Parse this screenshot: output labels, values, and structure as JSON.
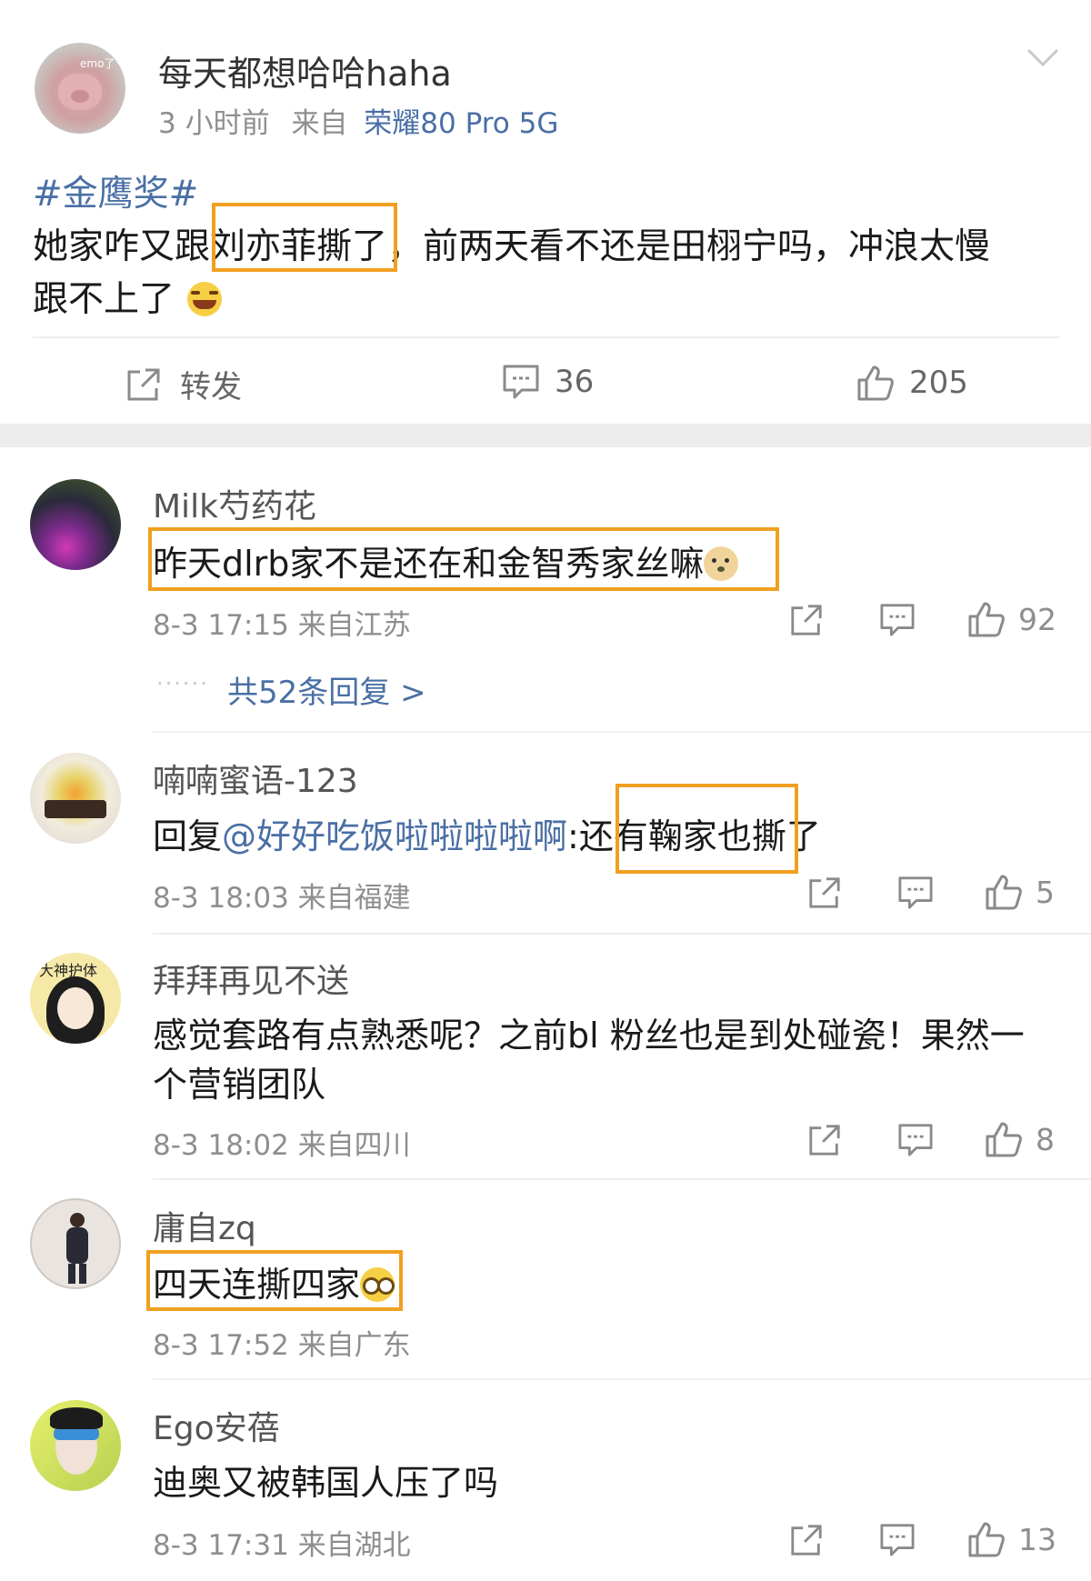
{
  "post": {
    "author": "每天都想哈哈haha",
    "time": "3 小时前",
    "from_prefix": "来自",
    "device": "荣耀80 Pro 5G",
    "hashtag": "#金鹰奖#",
    "text_line1": "她家咋又跟刘亦菲撕了，前两天看不还是田栩宁吗，冲浪太慢",
    "text_line2": "跟不上了",
    "avatar_badge": "emo了",
    "actions": {
      "repost_label": "转发",
      "comment_count": "36",
      "like_count": "205"
    }
  },
  "comments": [
    {
      "name": "Milk芍药花",
      "text": "昨天dlrb家不是还在和金智秀家丝嘛",
      "meta": "8-3 17:15 来自江苏",
      "likes": "92",
      "replies_label": "共52条回复 >"
    },
    {
      "name": "喃喃蜜语-123",
      "reply_prefix": "回复",
      "reply_mention": "@好好吃饭啦啦啦啦啊",
      "text": ":还有鞠家也撕了",
      "meta": "8-3 18:03 来自福建",
      "likes": "5"
    },
    {
      "name": "拜拜再见不送",
      "text_line1": "感觉套路有点熟悉呢？之前bl 粉丝也是到处碰瓷！果然一",
      "text_line2": "个营销团队",
      "meta": "8-3 18:02 来自四川",
      "likes": "8",
      "avatar_text": "大神护体"
    },
    {
      "name": "庸自zq",
      "text": "四天连撕四家",
      "meta": "8-3 17:52 来自广东"
    },
    {
      "name": "Ego安蓓",
      "text": "迪奥又被韩国人压了吗",
      "meta": "8-3 17:31 来自湖北",
      "likes": "13"
    }
  ],
  "colors": {
    "highlight_box": "#f0a020",
    "link": "#4a6fa5",
    "meta_grey": "#8e8e8e",
    "section_gap": "#ececec"
  }
}
